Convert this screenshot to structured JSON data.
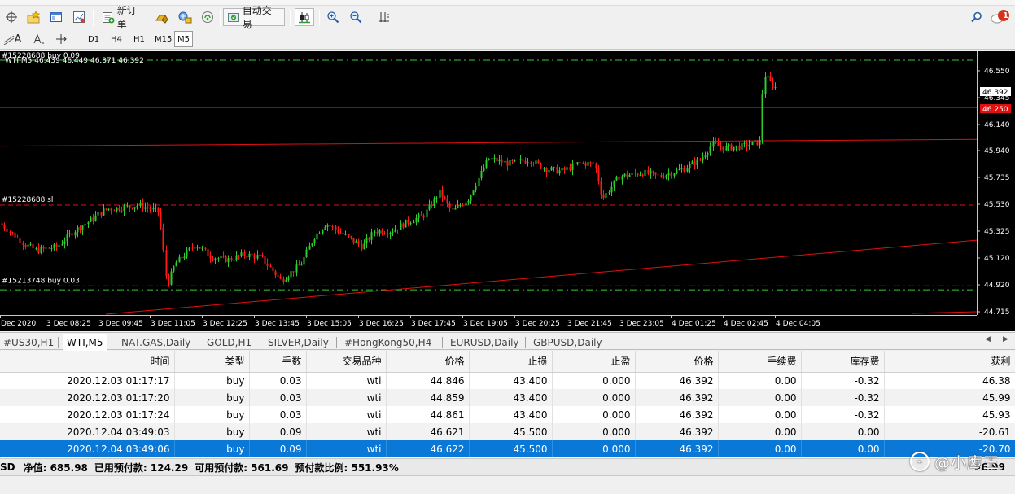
{
  "toolbar": {
    "new_order": "新订单",
    "auto_trade": "自动交易",
    "notification_count": "1"
  },
  "timeframes": [
    "D1",
    "H4",
    "H1",
    "M15",
    "M5"
  ],
  "active_timeframe": "M5",
  "chart": {
    "symbol_header": "WTI,M5  46.439 46.449 46.371 46.392",
    "order_top_label": "#15228688 buy 0.09",
    "sl_label": "#15228688 sl",
    "buy_low_label": "#15213748 buy 0.03",
    "price_ticks": [
      "46.550",
      "46.345",
      "46.140",
      "45.940",
      "45.735",
      "45.530",
      "45.325",
      "45.120",
      "44.920",
      "44.715"
    ],
    "current_price": "46.392",
    "level_price": "46.250",
    "time_ticks": [
      "Dec 2020",
      "3 Dec 08:25",
      "3 Dec 09:45",
      "3 Dec 11:05",
      "3 Dec 12:25",
      "3 Dec 13:45",
      "3 Dec 15:05",
      "3 Dec 16:25",
      "3 Dec 17:45",
      "3 Dec 19:05",
      "3 Dec 20:25",
      "3 Dec 21:45",
      "3 Dec 23:05",
      "4 Dec 01:25",
      "4 Dec 02:45",
      "4 Dec 04:05"
    ],
    "colors": {
      "bull": "#2ecc2e",
      "bear": "#ff1a1a",
      "line": "#e01010",
      "grid_dash": "#33cc33"
    },
    "price_range": [
      44.68,
      46.62
    ]
  },
  "tabs": [
    "#US30,H1",
    "WTI,M5",
    "NAT.GAS,Daily",
    "GOLD,H1",
    "SILVER,Daily",
    "#HongKong50,H4",
    "EURUSD,Daily",
    "GBPUSD,Daily"
  ],
  "active_tab": "WTI,M5",
  "table": {
    "headers": [
      "时间",
      "类型",
      "手数",
      "交易品种",
      "价格",
      "止损",
      "止盈",
      "价格",
      "手续费",
      "库存费",
      "获利"
    ],
    "rows": [
      [
        "2020.12.03 01:17:17",
        "buy",
        "0.03",
        "wti",
        "44.846",
        "43.400",
        "0.000",
        "46.392",
        "0.00",
        "-0.32",
        "46.38"
      ],
      [
        "2020.12.03 01:17:20",
        "buy",
        "0.03",
        "wti",
        "44.859",
        "43.400",
        "0.000",
        "46.392",
        "0.00",
        "-0.32",
        "45.99"
      ],
      [
        "2020.12.03 01:17:24",
        "buy",
        "0.03",
        "wti",
        "44.861",
        "43.400",
        "0.000",
        "46.392",
        "0.00",
        "-0.32",
        "45.93"
      ],
      [
        "2020.12.04 03:49:03",
        "buy",
        "0.09",
        "wti",
        "46.621",
        "45.500",
        "0.000",
        "46.392",
        "0.00",
        "0.00",
        "-20.61"
      ],
      [
        "2020.12.04 03:49:06",
        "buy",
        "0.09",
        "wti",
        "46.622",
        "45.500",
        "0.000",
        "46.392",
        "0.00",
        "0.00",
        "-20.70"
      ]
    ],
    "selected_row": 4
  },
  "status": {
    "prefix": "SD",
    "equity": "净值: 685.98",
    "margin": "已用预付款: 124.29",
    "free_margin": "可用预付款: 561.69",
    "margin_level": "预付款比例: 551.93%",
    "total": "96.99"
  },
  "watermark": "@小鹰玉"
}
